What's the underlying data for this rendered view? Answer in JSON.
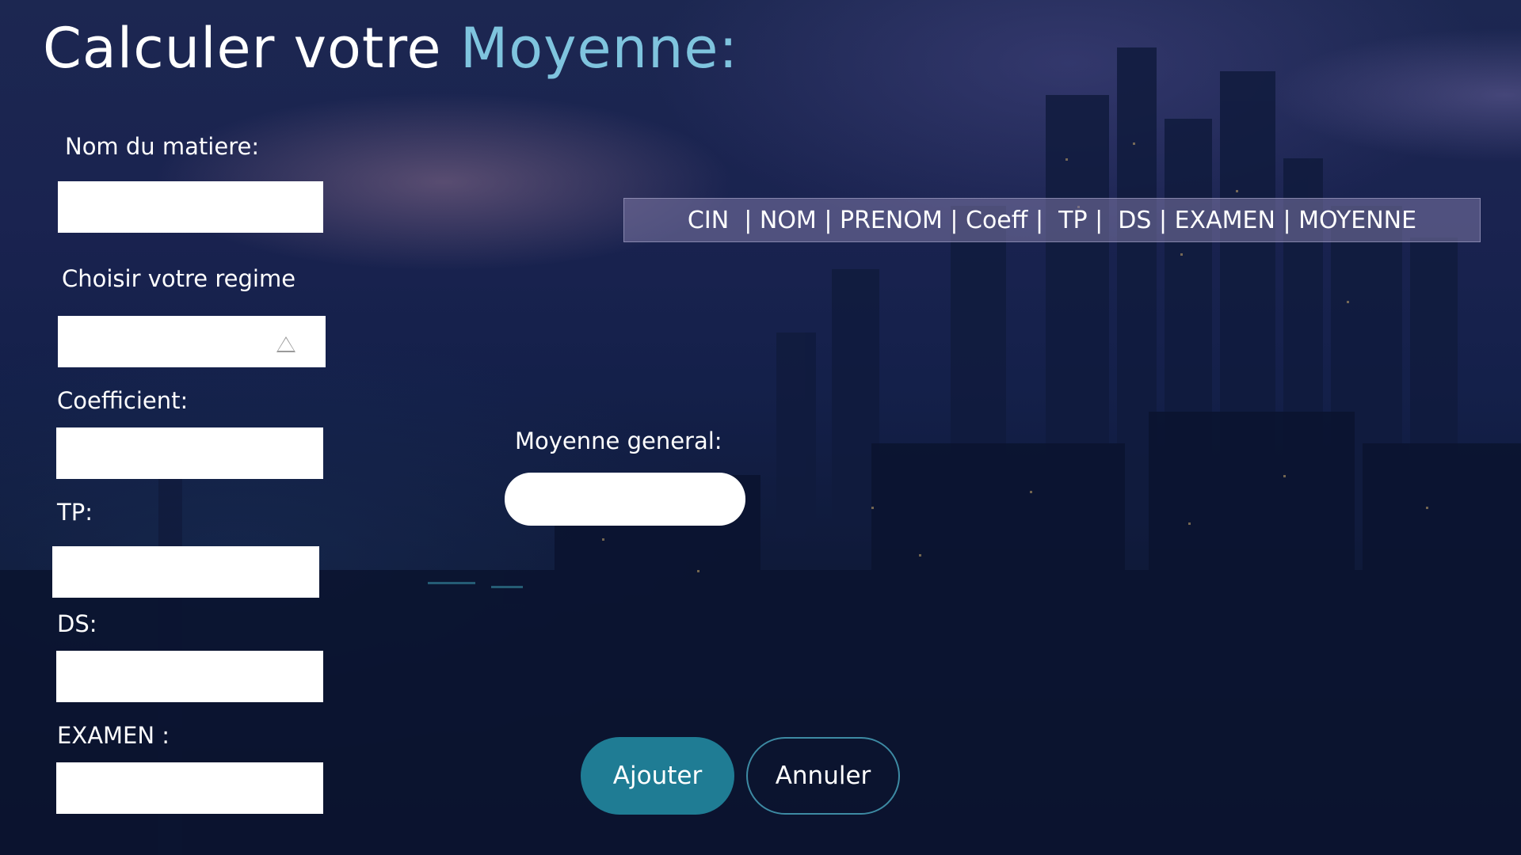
{
  "header": {
    "title_main": "Calculer votre",
    "title_accent": "Moyenne:"
  },
  "form": {
    "subject_label": "Nom du matiere:",
    "subject_value": "",
    "regime_label": "Choisir votre regime",
    "regime_value": "",
    "coefficient_label": "Coefficient:",
    "coefficient_value": "",
    "tp_label": "TP:",
    "tp_value": "",
    "ds_label": "DS:",
    "ds_value": "",
    "examen_label": "EXAMEN :",
    "examen_value": ""
  },
  "table": {
    "header_text": "CIN  | NOM | PRENOM | Coeff |  TP |  DS | EXAMEN | MOYENNE"
  },
  "result": {
    "general_label": "Moyenne general:",
    "general_value": ""
  },
  "actions": {
    "add_label": "Ajouter",
    "cancel_label": "Annuler"
  },
  "colors": {
    "accent": "#7fc4de",
    "primary_button": "#1f7c94",
    "background": "#0d1833"
  }
}
